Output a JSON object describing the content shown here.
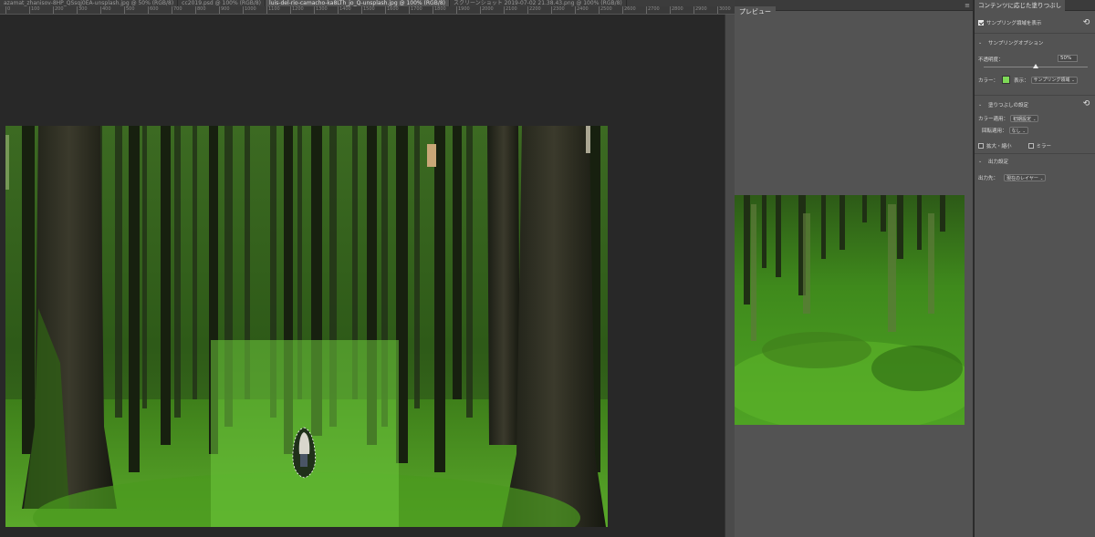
{
  "tabs": [
    {
      "label": "azamat_zhanisov-8HP_QSsqj0EA-unsplash.jpg @ 50% (RGB/8)"
    },
    {
      "label": "cc2019.psd @ 100% (RGB/8)"
    },
    {
      "label": "luis-del-rio-camacho-ka8LTh_jo_Q-unsplash.jpg @ 100% (RGB/8)"
    },
    {
      "label": "スクリーンショット 2019-07-02 21.38.43.png @ 100% (RGB/8)"
    }
  ],
  "ruler": [
    "0",
    "100",
    "200",
    "300",
    "400",
    "500",
    "600",
    "700",
    "800",
    "900",
    "1000",
    "1100",
    "1200",
    "1300",
    "1400",
    "1500",
    "1600",
    "1700",
    "1800",
    "1900",
    "2000",
    "2100",
    "2200",
    "2300",
    "2400",
    "2500",
    "2600",
    "2700",
    "2800",
    "2900",
    "3000"
  ],
  "preview": {
    "tab": "プレビュー",
    "menu": "≡"
  },
  "options": {
    "tab": "コンテンツに応じた塗りつぶし",
    "show_sampling": "サンプリング領域を表示",
    "sampling_options": "サンプリングオプション",
    "opacity_label": "不透明度：",
    "opacity_value": "50%",
    "opacity_fraction": 0.5,
    "color_label": "カラー：",
    "swatch_color": "#7ed957",
    "display_label": "表示：",
    "display_value": "サンプリング領域",
    "fill_settings": "塗りつぶしの設定",
    "color_adapt_label": "カラー適用：",
    "color_adapt_value": "初期設定",
    "rotation_label": "回転適用：",
    "rotation_value": "なし",
    "scale_label": "拡大・縮小",
    "mirror_label": "ミラー",
    "output_settings": "出力設定",
    "output_to_label": "出力先：",
    "output_to_value": "現在のレイヤー"
  }
}
